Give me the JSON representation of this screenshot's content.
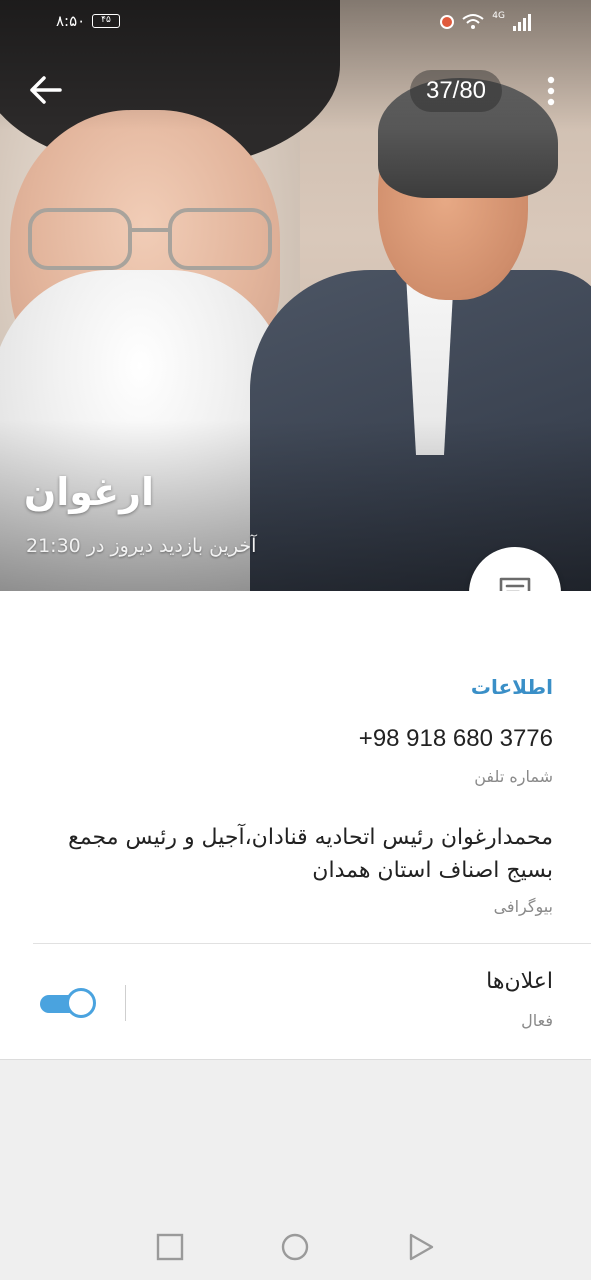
{
  "status_bar": {
    "time": "۸:۵۰",
    "battery": "۴۵",
    "network": "4G"
  },
  "header": {
    "back_icon": "arrow-left-icon",
    "counter": "37/80",
    "more_icon": "more-vert-icon",
    "name": "ارغوان",
    "last_seen": "آخرین بازدید دیروز در 21:30",
    "fab_icon": "message-icon"
  },
  "info": {
    "section_title": "اطلاعات",
    "phone": "+98 918 680 3776",
    "phone_label": "شماره تلفن",
    "bio": "محمدارغوان رئیس اتحادیه قنادان،آجیل و رئیس مجمع بسیج اصناف استان همدان",
    "bio_label": "بیوگرافی",
    "notifications_title": "اعلان‌ها",
    "notifications_status": "فعال",
    "notifications_enabled": true
  },
  "nav": {
    "recents_icon": "square-icon",
    "home_icon": "circle-icon",
    "back_icon": "triangle-back-icon"
  },
  "colors": {
    "accent": "#3a8fc7",
    "toggle": "#4aa3df"
  }
}
